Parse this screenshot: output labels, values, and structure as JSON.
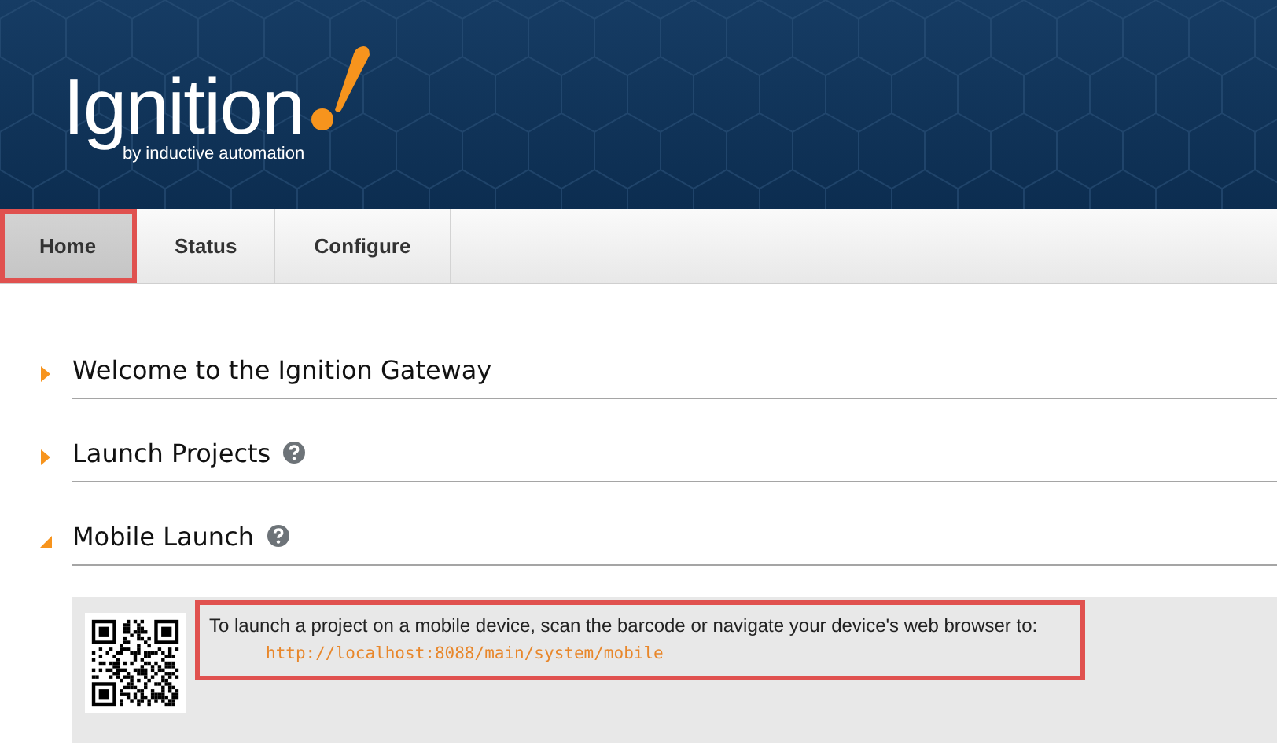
{
  "header": {
    "logo": {
      "name": "Ignition",
      "tagline": "by inductive automation"
    }
  },
  "tabs": [
    {
      "label": "Home",
      "selected": true,
      "highlighted": true
    },
    {
      "label": "Status",
      "selected": false,
      "highlighted": false
    },
    {
      "label": "Configure",
      "selected": false,
      "highlighted": false
    }
  ],
  "sections": [
    {
      "title": "Welcome to the Ignition Gateway",
      "expanded": false,
      "help": false
    },
    {
      "title": "Launch Projects",
      "expanded": false,
      "help": true
    },
    {
      "title": "Mobile Launch",
      "expanded": true,
      "help": true,
      "message": {
        "text": "To launch a project on a mobile device, scan the barcode or navigate your device's web browser to:",
        "url": "http://localhost:8088/main/system/mobile",
        "highlighted": true
      }
    }
  ]
}
